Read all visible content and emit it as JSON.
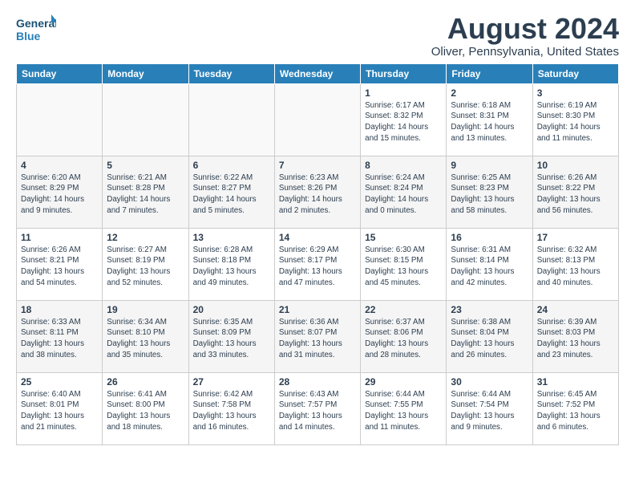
{
  "header": {
    "logo_line1": "General",
    "logo_line2": "Blue",
    "month_year": "August 2024",
    "location": "Oliver, Pennsylvania, United States"
  },
  "days_of_week": [
    "Sunday",
    "Monday",
    "Tuesday",
    "Wednesday",
    "Thursday",
    "Friday",
    "Saturday"
  ],
  "weeks": [
    [
      {
        "day": "",
        "info": ""
      },
      {
        "day": "",
        "info": ""
      },
      {
        "day": "",
        "info": ""
      },
      {
        "day": "",
        "info": ""
      },
      {
        "day": "1",
        "info": "Sunrise: 6:17 AM\nSunset: 8:32 PM\nDaylight: 14 hours and 15 minutes."
      },
      {
        "day": "2",
        "info": "Sunrise: 6:18 AM\nSunset: 8:31 PM\nDaylight: 14 hours and 13 minutes."
      },
      {
        "day": "3",
        "info": "Sunrise: 6:19 AM\nSunset: 8:30 PM\nDaylight: 14 hours and 11 minutes."
      }
    ],
    [
      {
        "day": "4",
        "info": "Sunrise: 6:20 AM\nSunset: 8:29 PM\nDaylight: 14 hours and 9 minutes."
      },
      {
        "day": "5",
        "info": "Sunrise: 6:21 AM\nSunset: 8:28 PM\nDaylight: 14 hours and 7 minutes."
      },
      {
        "day": "6",
        "info": "Sunrise: 6:22 AM\nSunset: 8:27 PM\nDaylight: 14 hours and 5 minutes."
      },
      {
        "day": "7",
        "info": "Sunrise: 6:23 AM\nSunset: 8:26 PM\nDaylight: 14 hours and 2 minutes."
      },
      {
        "day": "8",
        "info": "Sunrise: 6:24 AM\nSunset: 8:24 PM\nDaylight: 14 hours and 0 minutes."
      },
      {
        "day": "9",
        "info": "Sunrise: 6:25 AM\nSunset: 8:23 PM\nDaylight: 13 hours and 58 minutes."
      },
      {
        "day": "10",
        "info": "Sunrise: 6:26 AM\nSunset: 8:22 PM\nDaylight: 13 hours and 56 minutes."
      }
    ],
    [
      {
        "day": "11",
        "info": "Sunrise: 6:26 AM\nSunset: 8:21 PM\nDaylight: 13 hours and 54 minutes."
      },
      {
        "day": "12",
        "info": "Sunrise: 6:27 AM\nSunset: 8:19 PM\nDaylight: 13 hours and 52 minutes."
      },
      {
        "day": "13",
        "info": "Sunrise: 6:28 AM\nSunset: 8:18 PM\nDaylight: 13 hours and 49 minutes."
      },
      {
        "day": "14",
        "info": "Sunrise: 6:29 AM\nSunset: 8:17 PM\nDaylight: 13 hours and 47 minutes."
      },
      {
        "day": "15",
        "info": "Sunrise: 6:30 AM\nSunset: 8:15 PM\nDaylight: 13 hours and 45 minutes."
      },
      {
        "day": "16",
        "info": "Sunrise: 6:31 AM\nSunset: 8:14 PM\nDaylight: 13 hours and 42 minutes."
      },
      {
        "day": "17",
        "info": "Sunrise: 6:32 AM\nSunset: 8:13 PM\nDaylight: 13 hours and 40 minutes."
      }
    ],
    [
      {
        "day": "18",
        "info": "Sunrise: 6:33 AM\nSunset: 8:11 PM\nDaylight: 13 hours and 38 minutes."
      },
      {
        "day": "19",
        "info": "Sunrise: 6:34 AM\nSunset: 8:10 PM\nDaylight: 13 hours and 35 minutes."
      },
      {
        "day": "20",
        "info": "Sunrise: 6:35 AM\nSunset: 8:09 PM\nDaylight: 13 hours and 33 minutes."
      },
      {
        "day": "21",
        "info": "Sunrise: 6:36 AM\nSunset: 8:07 PM\nDaylight: 13 hours and 31 minutes."
      },
      {
        "day": "22",
        "info": "Sunrise: 6:37 AM\nSunset: 8:06 PM\nDaylight: 13 hours and 28 minutes."
      },
      {
        "day": "23",
        "info": "Sunrise: 6:38 AM\nSunset: 8:04 PM\nDaylight: 13 hours and 26 minutes."
      },
      {
        "day": "24",
        "info": "Sunrise: 6:39 AM\nSunset: 8:03 PM\nDaylight: 13 hours and 23 minutes."
      }
    ],
    [
      {
        "day": "25",
        "info": "Sunrise: 6:40 AM\nSunset: 8:01 PM\nDaylight: 13 hours and 21 minutes."
      },
      {
        "day": "26",
        "info": "Sunrise: 6:41 AM\nSunset: 8:00 PM\nDaylight: 13 hours and 18 minutes."
      },
      {
        "day": "27",
        "info": "Sunrise: 6:42 AM\nSunset: 7:58 PM\nDaylight: 13 hours and 16 minutes."
      },
      {
        "day": "28",
        "info": "Sunrise: 6:43 AM\nSunset: 7:57 PM\nDaylight: 13 hours and 14 minutes."
      },
      {
        "day": "29",
        "info": "Sunrise: 6:44 AM\nSunset: 7:55 PM\nDaylight: 13 hours and 11 minutes."
      },
      {
        "day": "30",
        "info": "Sunrise: 6:44 AM\nSunset: 7:54 PM\nDaylight: 13 hours and 9 minutes."
      },
      {
        "day": "31",
        "info": "Sunrise: 6:45 AM\nSunset: 7:52 PM\nDaylight: 13 hours and 6 minutes."
      }
    ]
  ]
}
